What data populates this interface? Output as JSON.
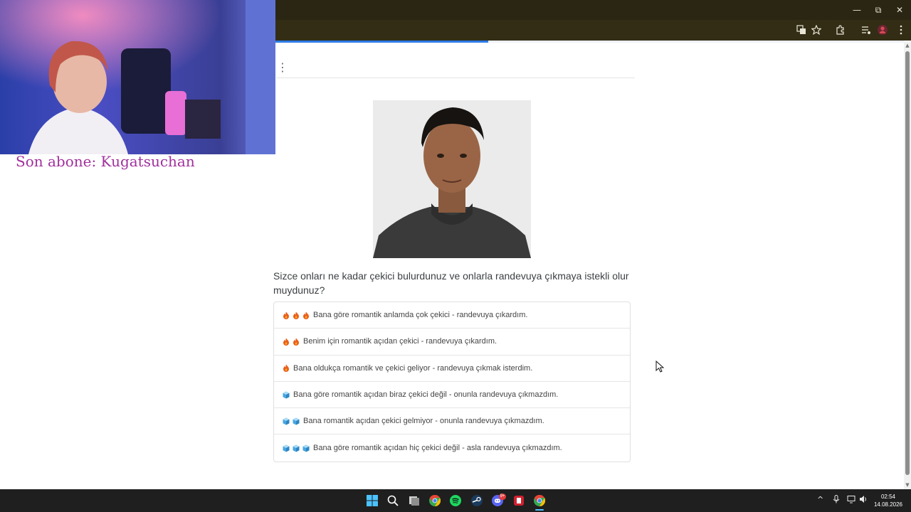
{
  "window_controls": {
    "minimize": "—",
    "restore": "⧉",
    "close": "✕"
  },
  "toolbar_icons": [
    "translate-icon",
    "star-icon",
    "extensions-icon",
    "media-icon",
    "profile-icon",
    "menu-icon"
  ],
  "page_progress": 0.54,
  "survey": {
    "question": "Sizce onları ne kadar çekici bulurdunuz ve onlarla randevuya çıkmaya istekli olur muydunuz?",
    "options": [
      {
        "emoji": "fire",
        "count": 3,
        "label": "Bana göre romantik anlamda çok çekici - randevuya çıkardım."
      },
      {
        "emoji": "fire",
        "count": 2,
        "label": "Benim için romantik açıdan çekici - randevuya çıkardım."
      },
      {
        "emoji": "fire",
        "count": 1,
        "label": "Bana oldukça romantik ve çekici geliyor - randevuya çıkmak isterdim."
      },
      {
        "emoji": "ice",
        "count": 1,
        "label": "Bana göre romantik açıdan biraz çekici değil - onunla randevuya çıkmazdım."
      },
      {
        "emoji": "ice",
        "count": 2,
        "label": "Bana romantik açıdan çekici gelmiyor - onunla randevuya çıkmazdım."
      },
      {
        "emoji": "ice",
        "count": 3,
        "label": "Bana göre romantik açıdan hiç çekici değil - asla randevuya çıkmazdım."
      }
    ]
  },
  "stream_overlay": {
    "text": "Son abone: Kugatsuchan"
  },
  "colors": {
    "fire": "#e8601c",
    "ice": "#48a6e0",
    "overlay_text": "#a12f9c",
    "progress": "#2f7be5"
  },
  "taskbar": {
    "apps": [
      "windows-start-icon",
      "search-icon",
      "task-view-icon",
      "chrome-icon",
      "spotify-icon",
      "steam-icon",
      "discord-icon",
      "app-red-icon",
      "chrome-active-icon"
    ],
    "discord_badge": "9+",
    "clock": {
      "time": "02:54",
      "date": "14.08.2026"
    }
  }
}
